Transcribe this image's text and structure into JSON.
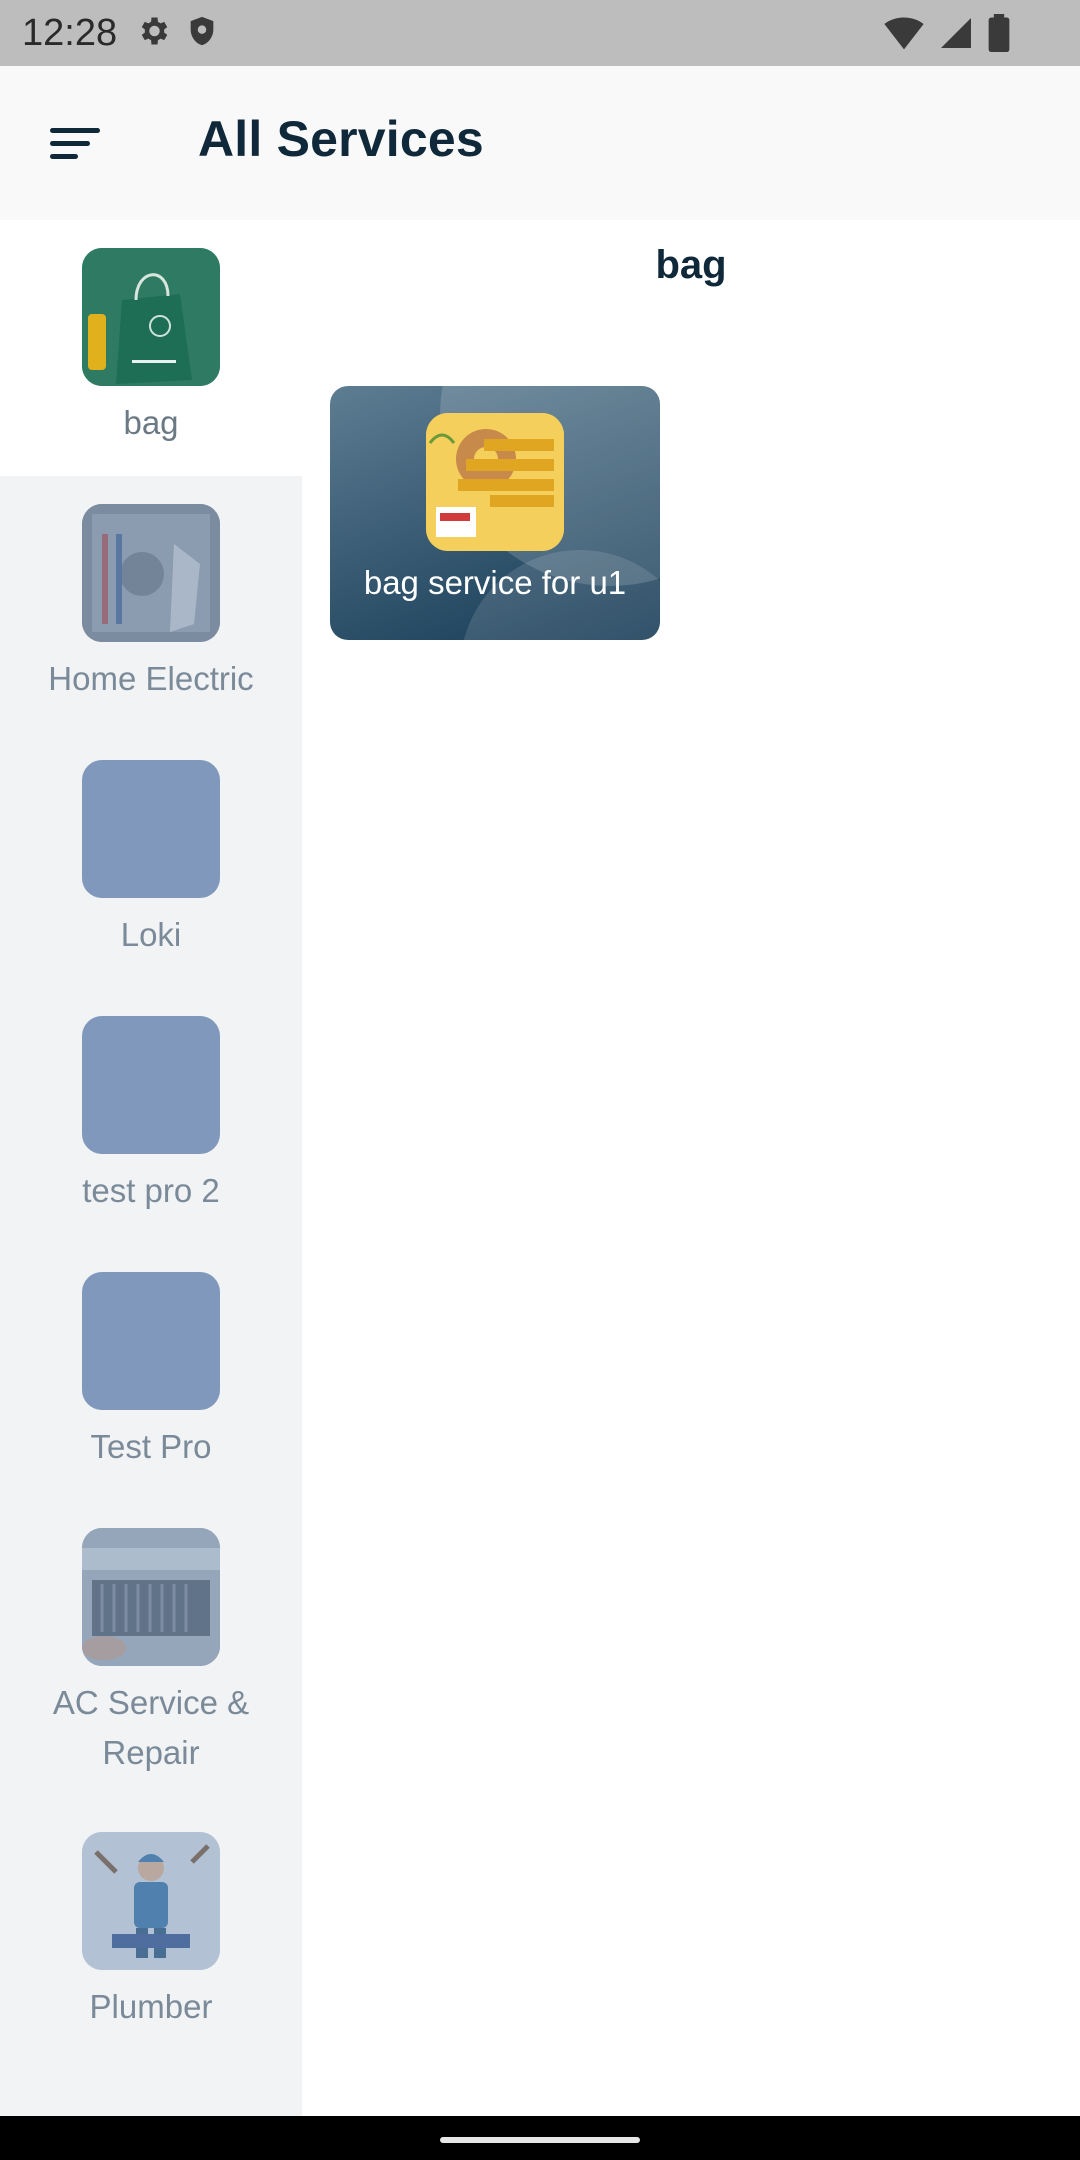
{
  "status_bar": {
    "time": "12:28",
    "icons": [
      "gear-icon",
      "shield-icon",
      "wifi-icon",
      "signal-icon",
      "battery-icon"
    ]
  },
  "header": {
    "title": "All Services",
    "menu_icon": "sort-menu-icon"
  },
  "sidebar": {
    "items": [
      {
        "label": "bag",
        "thumb": "green-bag-image",
        "active": true
      },
      {
        "label": "Home Electric",
        "thumb": "electric-panel-image",
        "active": false
      },
      {
        "label": "Loki",
        "thumb": "placeholder",
        "active": false
      },
      {
        "label": "test pro 2",
        "thumb": "placeholder",
        "active": false
      },
      {
        "label": "Test Pro",
        "thumb": "placeholder",
        "active": false
      },
      {
        "label": "AC Service & Repair",
        "thumb": "ac-unit-image",
        "active": false
      },
      {
        "label": "Plumber",
        "thumb": "plumber-image",
        "active": false
      }
    ]
  },
  "main": {
    "section_title": "bag",
    "services": [
      {
        "label": "bag service for u1",
        "thumb": "food-ad-image"
      }
    ]
  },
  "colors": {
    "title": "#10293a",
    "sidebar_bg": "#f1f3f5",
    "placeholder_thumb": "#7f98bb",
    "card_gradient_dark": "#163b56"
  }
}
